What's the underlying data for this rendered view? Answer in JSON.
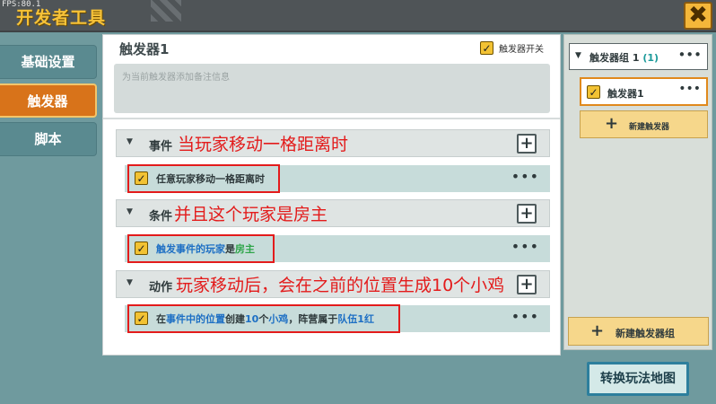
{
  "window": {
    "fps": "FPS:80.1",
    "title": "开发者工具",
    "close_symbol": "✖"
  },
  "sidebar": {
    "items": [
      {
        "label": "基础设置",
        "active": false
      },
      {
        "label": "触发器",
        "active": true
      },
      {
        "label": "脚本",
        "active": false
      }
    ]
  },
  "main": {
    "trigger_name": "触发器1",
    "switch_label": "触发器开关",
    "switch_checked": true,
    "note_placeholder": "为当前触发器添加备注信息",
    "sections": [
      {
        "label": "事件",
        "annotation": "当玩家移动一格距离时",
        "item": {
          "parts": [
            {
              "text": "任意玩家移动一格距离时",
              "style": "plain"
            }
          ]
        }
      },
      {
        "label": "条件",
        "annotation": "并且这个玩家是房主",
        "item": {
          "parts": [
            {
              "text": "触发事件的玩家",
              "style": "blue"
            },
            {
              "text": "是",
              "style": "plain"
            },
            {
              "text": "房主",
              "style": "green"
            }
          ]
        }
      },
      {
        "label": "动作",
        "annotation": "玩家移动后，会在之前的位置生成10个小鸡",
        "item": {
          "parts": [
            {
              "text": "在",
              "style": "plain"
            },
            {
              "text": "事件中的位置",
              "style": "blue"
            },
            {
              "text": "创建",
              "style": "plain"
            },
            {
              "text": "10",
              "style": "blue"
            },
            {
              "text": "个",
              "style": "plain"
            },
            {
              "text": "小鸡",
              "style": "blue"
            },
            {
              "text": "，阵营属于",
              "style": "plain"
            },
            {
              "text": "队伍1红",
              "style": "blue"
            }
          ]
        }
      }
    ],
    "plus_symbol": "+",
    "more_symbol": "•••"
  },
  "right_panel": {
    "group_name": "触发器组 1",
    "group_count": "(1)",
    "trigger_item": "触发器1",
    "new_trigger_label": "新建触发器",
    "new_group_label": "新建触发器组",
    "plus_symbol": "+",
    "more_symbol": "•••"
  },
  "footer": {
    "switch_map_label": "转换玩法地图"
  },
  "colors": {
    "accent_orange": "#d8731a",
    "checkbox_yellow": "#f2c233",
    "annotation_red": "#e31b1b",
    "link_blue": "#1d6fc4",
    "highlight_green": "#2fa54a"
  },
  "icons": {
    "close": "close-icon",
    "checkbox": "check-icon",
    "expand": "triangle-down-icon",
    "add": "plus-icon",
    "more": "more-dots-icon"
  }
}
